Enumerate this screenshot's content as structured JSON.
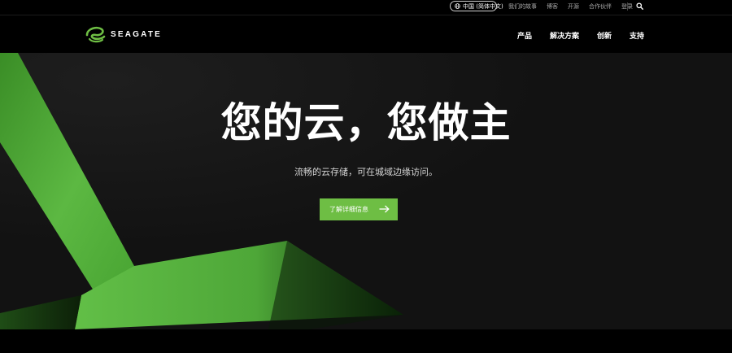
{
  "utility_bar": {
    "region_label": "中国 (简体中文)",
    "links": [
      "我们的故事",
      "博客",
      "开源",
      "合作伙伴",
      "登录"
    ]
  },
  "brand": {
    "name": "SEAGATE",
    "accent": "#6ebe44"
  },
  "main_nav": {
    "items": [
      "产品",
      "解决方案",
      "创新",
      "支持"
    ]
  },
  "hero": {
    "title": "您的云，您做主",
    "subtitle": "流畅的云存储，可在城域边缘访问。",
    "cta_label": "了解详细信息",
    "cta_icon": "arrow-right-icon"
  },
  "icons": [
    "globe-icon",
    "search-icon",
    "seagate-logo-icon",
    "arrow-right-icon"
  ]
}
